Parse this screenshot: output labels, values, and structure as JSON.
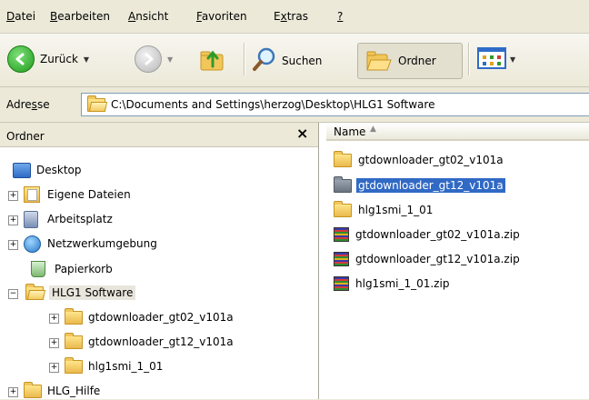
{
  "menu": {
    "datei": {
      "u": "D",
      "rest": "atei"
    },
    "bearbeiten": {
      "u": "B",
      "rest": "earbeiten"
    },
    "ansicht": {
      "u": "A",
      "rest": "nsicht"
    },
    "favoriten": {
      "u": "F",
      "rest": "avoriten"
    },
    "extras": {
      "pre": "E",
      "u": "x",
      "rest": "tras"
    },
    "help": {
      "u": "?"
    }
  },
  "toolbar": {
    "back_label": "Zurück",
    "search_label": "Suchen",
    "folders_label": "Ordner"
  },
  "address": {
    "label_pre": "Adre",
    "label_u": "s",
    "label_rest": "se",
    "value": "C:\\Documents and Settings\\herzog\\Desktop\\HLG1 Software"
  },
  "left_pane": {
    "title": "Ordner",
    "close_glyph": "×",
    "tree": [
      {
        "label": "Desktop"
      },
      {
        "label": "Eigene Dateien"
      },
      {
        "label": "Arbeitsplatz"
      },
      {
        "label": "Netzwerkumgebung"
      },
      {
        "label": "Papierkorb"
      },
      {
        "label": "HLG1 Software"
      },
      {
        "label": "gtdownloader_gt02_v101a"
      },
      {
        "label": "gtdownloader_gt12_v101a"
      },
      {
        "label": "hlg1smi_1_01"
      },
      {
        "label": "HLG_Hilfe"
      }
    ]
  },
  "right_pane": {
    "column_name": "Name",
    "files": [
      {
        "name": "gtdownloader_gt02_v101a"
      },
      {
        "name": "gtdownloader_gt12_v101a"
      },
      {
        "name": "hlg1smi_1_01"
      },
      {
        "name": "gtdownloader_gt02_v101a.zip"
      },
      {
        "name": "gtdownloader_gt12_v101a.zip"
      },
      {
        "name": "hlg1smi_1_01.zip"
      }
    ]
  },
  "colors": {
    "selection": "#316ac5",
    "chrome": "#ece9d8"
  }
}
